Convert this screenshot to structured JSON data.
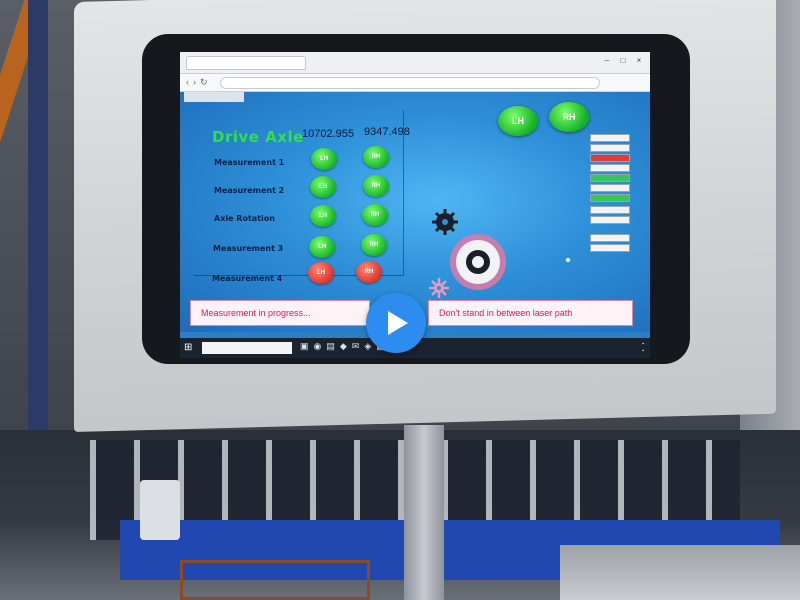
{
  "app": {
    "title": "Drive Axle",
    "reading_1": "10702.955",
    "reading_2": "9347.498",
    "header_buttons": [
      {
        "label": "LH",
        "color": "#16b52a"
      },
      {
        "label": "RH",
        "color": "#16b52a"
      }
    ],
    "rows": [
      {
        "label": "Measurement 1",
        "lh": "LH",
        "rh": "RH",
        "state": "green"
      },
      {
        "label": "Measurement 2",
        "lh": "LH",
        "rh": "RH",
        "state": "green"
      },
      {
        "label": "Axle Rotation",
        "lh": "LH",
        "rh": "RH",
        "state": "green"
      },
      {
        "label": "Measurement 3",
        "lh": "LH",
        "rh": "RH",
        "state": "green"
      },
      {
        "label": "Measurement 4",
        "lh": "LH",
        "rh": "RH",
        "state": "red"
      }
    ],
    "status_left": "Measurement in progress...",
    "status_right": "Don't stand in between laser path"
  },
  "icons": {
    "gears": [
      "gear-icon",
      "gear-icon",
      "gear-icon"
    ],
    "play": "play-icon",
    "windows": "windows-logo-icon"
  },
  "colors": {
    "ok": "#16b52a",
    "fault": "#e0332a",
    "title_green": "#2ee04a",
    "status_text": "#d0205a",
    "screen_bg": "#2d8fd7"
  }
}
